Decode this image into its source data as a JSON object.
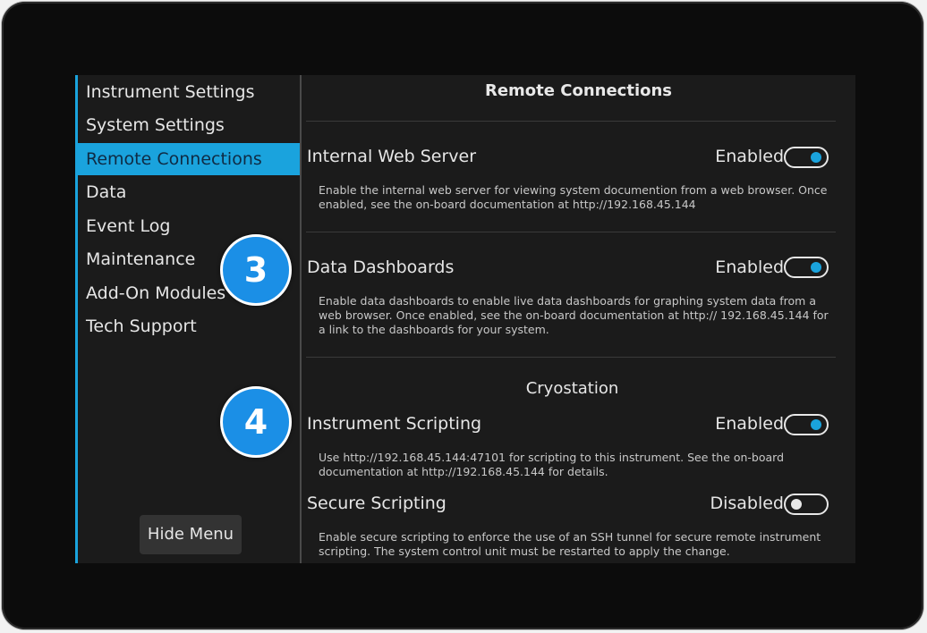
{
  "sidebar": {
    "items": [
      {
        "label": "Instrument Settings",
        "active": false
      },
      {
        "label": "System Settings",
        "active": false
      },
      {
        "label": "Remote Connections",
        "active": true
      },
      {
        "label": "Data",
        "active": false
      },
      {
        "label": "Event Log",
        "active": false
      },
      {
        "label": "Maintenance",
        "active": false
      },
      {
        "label": "Add-On Modules",
        "active": false
      },
      {
        "label": "Tech Support",
        "active": false
      }
    ],
    "hide_menu_label": "Hide Menu"
  },
  "main": {
    "title": "Remote Connections",
    "settings": [
      {
        "label": "Internal Web Server",
        "status": "Enabled",
        "on": true,
        "description": "Enable the internal web server for viewing system documention from a web browser. Once enabled, see the on-board documentation at http://192.168.45.144"
      },
      {
        "label": "Data Dashboards",
        "status": "Enabled",
        "on": true,
        "description": "Enable data dashboards to enable live data dashboards for graphing system data from a web browser. Once enabled, see the on-board documentation at http:// 192.168.45.144 for a link to the dashboards for your system."
      },
      {
        "label": "Instrument Scripting",
        "status": "Enabled",
        "on": true,
        "description": "Use http://192.168.45.144:47101 for scripting to this instrument. See the on-board documentation at http://192.168.45.144 for details."
      },
      {
        "label": "Secure Scripting",
        "status": "Disabled",
        "on": false,
        "description": "Enable secure scripting to enforce the use of an SSH tunnel for secure remote instrument scripting.  The system control unit must be restarted to apply the change."
      }
    ],
    "section_heading": "Cryostation"
  },
  "callouts": [
    "3",
    "4"
  ],
  "colors": {
    "accent": "#1aa3dd",
    "callout": "#1b8fe6",
    "background": "#1b1b1b",
    "bezel": "#0c0c0c"
  }
}
